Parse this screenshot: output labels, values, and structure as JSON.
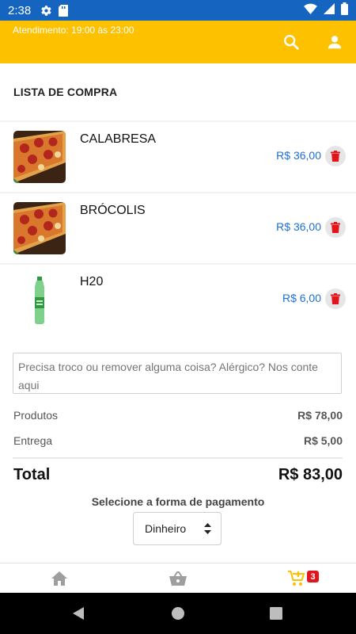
{
  "status_bar": {
    "time": "2:38",
    "icons": [
      "gear-icon",
      "sd-card-icon",
      "wifi-icon",
      "signal-icon",
      "battery-icon"
    ]
  },
  "header": {
    "hours": "Atendimento: 19:00 às 23:00",
    "icons": [
      "search-icon",
      "user-icon"
    ],
    "color": "#fdc100"
  },
  "cart": {
    "title": "LISTA DE COMPRA",
    "items": [
      {
        "name": "CALABRESA",
        "price": "R$ 36,00",
        "image": "pizza"
      },
      {
        "name": "BRÓCOLIS",
        "price": "R$ 36,00",
        "image": "pizza"
      },
      {
        "name": "H20",
        "price": "R$ 6,00",
        "image": "bottle"
      }
    ]
  },
  "summary": {
    "note_placeholder": "Precisa troco ou remover alguma coisa? Alérgico? Nos conte aqui",
    "products_label": "Produtos",
    "products_value": "R$ 78,00",
    "delivery_label": "Entrega",
    "delivery_value": "R$ 5,00",
    "total_label": "Total",
    "total_value": "R$ 83,00",
    "payment_label": "Selecione a forma de pagamento",
    "payment_selected": "Dinheiro"
  },
  "tabs": {
    "items": [
      "home-icon",
      "basket-icon",
      "cart-icon"
    ],
    "cart_badge": "3",
    "active_color": "#fdc100"
  },
  "colors": {
    "accent": "#fdc100",
    "price": "#1d6fd6",
    "delete": "#e3151c",
    "status_bar": "#1565c0"
  }
}
